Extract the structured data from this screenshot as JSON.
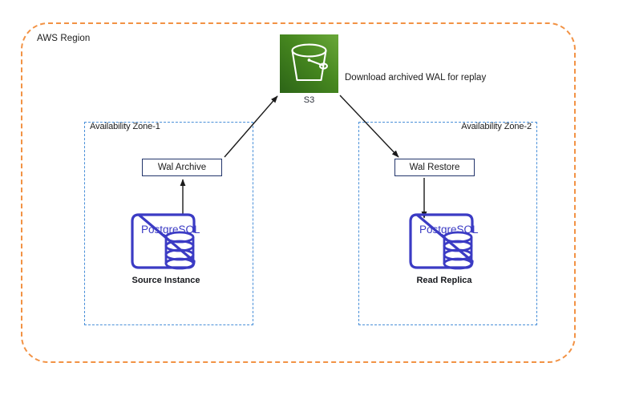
{
  "diagram": {
    "region": {
      "label": "AWS Region",
      "border_color": "#f29244"
    },
    "zones": [
      {
        "label": "Availability Zone-1",
        "border_color": "#4a90d9"
      },
      {
        "label": "Availability Zone-2",
        "border_color": "#4a90d9"
      }
    ],
    "storage": {
      "icon": "s3-bucket-icon",
      "label": "S3",
      "color_light": "#6aa839",
      "color_dark": "#2c6417"
    },
    "processes": [
      {
        "name": "wal-archive",
        "label": "Wal Archive",
        "border_color": "#23356b"
      },
      {
        "name": "wal-restore",
        "label": "Wal Restore",
        "border_color": "#23356b"
      }
    ],
    "databases": [
      {
        "name": "source-instance",
        "icon": "postgresql-icon",
        "icon_label": "PostgreSQL",
        "caption": "Source Instance",
        "color": "#3b3bc4"
      },
      {
        "name": "read-replica",
        "icon": "postgresql-icon",
        "icon_label": "PostgreSQL",
        "caption": "Read Replica",
        "color": "#3b3bc4"
      }
    ],
    "connections": [
      {
        "name": "source-to-wal-archive",
        "from": "Source Instance",
        "to": "Wal Archive",
        "label": ""
      },
      {
        "name": "wal-archive-to-s3",
        "from": "Wal Archive",
        "to": "S3",
        "label": ""
      },
      {
        "name": "s3-to-wal-restore",
        "from": "S3",
        "to": "Wal Restore",
        "label": "Download archived WAL for replay"
      },
      {
        "name": "wal-restore-to-replica",
        "from": "Wal Restore",
        "to": "Read Replica",
        "label": ""
      }
    ],
    "arrow_color": "#1a1a1a"
  }
}
